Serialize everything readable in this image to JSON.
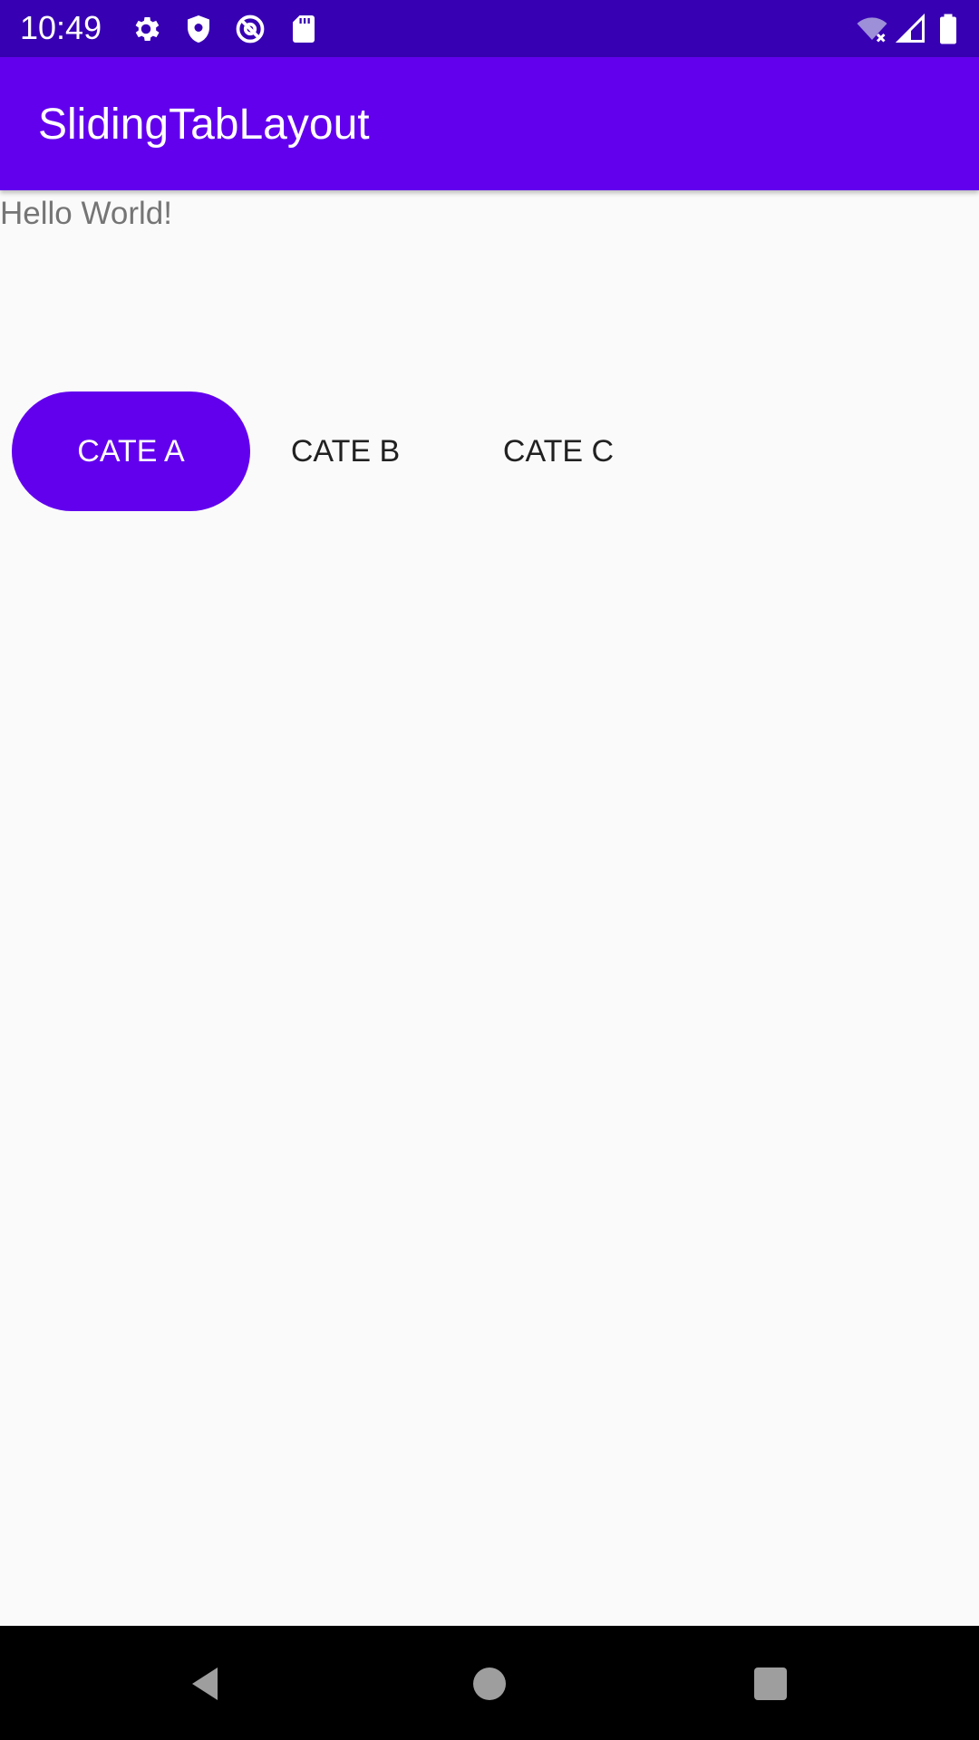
{
  "status_bar": {
    "time": "10:49",
    "icons": [
      "gear-icon",
      "shield-icon",
      "at-sign-icon",
      "sd-card-icon",
      "wifi-off-icon",
      "cell-signal-icon",
      "battery-icon"
    ],
    "background": "#3700b3"
  },
  "app_bar": {
    "title": "SlidingTabLayout",
    "background": "#6200ee"
  },
  "main": {
    "hello_text": "Hello World!"
  },
  "tabs": {
    "items": [
      {
        "label": "CATE A",
        "selected": true
      },
      {
        "label": "CATE B",
        "selected": false
      },
      {
        "label": "CATE C",
        "selected": false
      }
    ],
    "indicator_color": "#6200ee"
  },
  "nav_bar": {
    "buttons": [
      "back-icon",
      "home-icon",
      "recents-icon"
    ]
  }
}
